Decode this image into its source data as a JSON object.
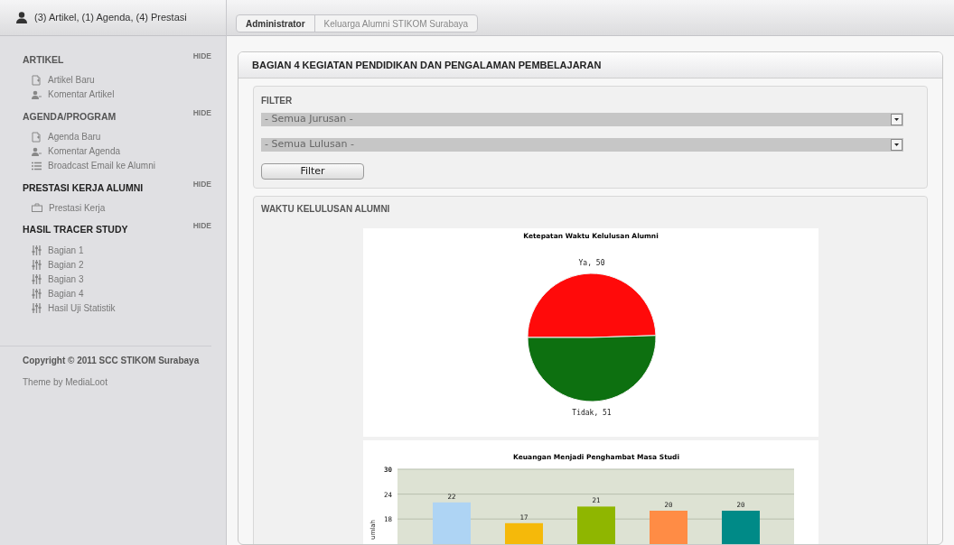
{
  "sidebar": {
    "user_summary": "(3) Artikel, (1) Agenda, (4) Prestasi",
    "sections": [
      {
        "title": "ARTIKEL",
        "active": false,
        "hide": "HIDE",
        "items": [
          {
            "kind": "new",
            "label": "Artikel Baru"
          },
          {
            "kind": "users",
            "label": "Komentar Artikel"
          }
        ]
      },
      {
        "title": "AGENDA/PROGRAM",
        "active": false,
        "hide": "HIDE",
        "items": [
          {
            "kind": "new",
            "label": "Agenda Baru"
          },
          {
            "kind": "users",
            "label": "Komentar Agenda"
          },
          {
            "kind": "list",
            "label": "Broadcast Email ke Alumni"
          }
        ]
      },
      {
        "title": "PRESTASI KERJA ALUMNI",
        "active": true,
        "hide": "HIDE",
        "items": [
          {
            "kind": "briefcase",
            "label": "Prestasi Kerja"
          }
        ]
      },
      {
        "title": "HASIL TRACER STUDY",
        "active": true,
        "hide": "HIDE",
        "items": [
          {
            "kind": "sliders",
            "label": "Bagian 1"
          },
          {
            "kind": "sliders",
            "label": "Bagian 2"
          },
          {
            "kind": "sliders",
            "label": "Bagian 3"
          },
          {
            "kind": "sliders",
            "label": "Bagian 4"
          },
          {
            "kind": "sliders",
            "label": "Hasil Uji Statistik"
          }
        ]
      }
    ],
    "copyright": "Copyright © 2011 SCC STIKOM Surabaya",
    "theme": "Theme by MediaLoot"
  },
  "breadcrumb": [
    "Administrator",
    "Keluarga Alumni STIKOM Surabaya"
  ],
  "panel": {
    "title": "BAGIAN 4 KEGIATAN PENDIDIKAN DAN PENGALAMAN PEMBELAJARAN",
    "filter": {
      "title": "FILTER",
      "selects": [
        {
          "value": "- Semua Jurusan -"
        },
        {
          "value": "- Semua Lulusan -"
        }
      ],
      "button": "Filter"
    },
    "section_title": "WAKTU KELULUSAN ALUMNI",
    "pie": {
      "chart_data": {
        "type": "pie",
        "title": "Ketepatan Waktu Kelulusan Alumni",
        "values": [
          50,
          51
        ],
        "colors": [
          "#ff0a0a",
          "#0d7010"
        ],
        "value_labels": [
          "Ya, 50",
          "Tidak, 51"
        ]
      }
    },
    "bar": {
      "chart_data": {
        "type": "bar",
        "title": "Keuangan Menjadi Penghambat Masa Studi",
        "ylabel": "umlah",
        "values": [
          22,
          17,
          21,
          20,
          20
        ],
        "colors": [
          "#aed4f4",
          "#f5b90a",
          "#8fb600",
          "#ff8c45",
          "#008a87"
        ],
        "ylim": [
          0,
          30
        ],
        "yticks": [
          18,
          24,
          30
        ],
        "data_labels": true
      }
    }
  }
}
